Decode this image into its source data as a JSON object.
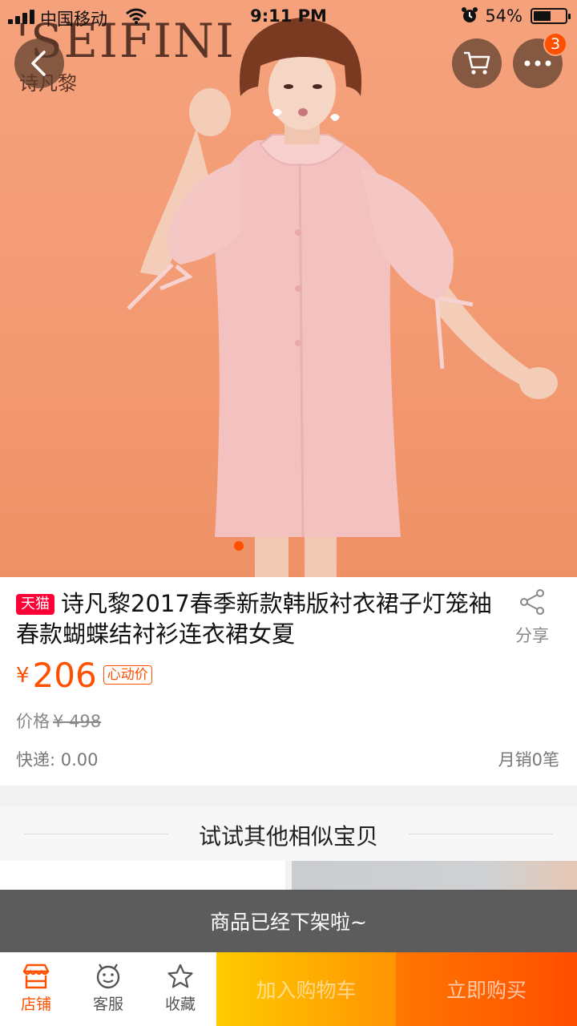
{
  "status_bar": {
    "carrier": "中国移动",
    "time": "9:11 PM",
    "battery_percent": "54%",
    "battery_level": 0.54
  },
  "hero": {
    "brand_logo": "'SEIFINI",
    "brand_sub": "诗凡黎",
    "image_count_current": 1
  },
  "nav": {
    "back_icon": "chevron-left-icon",
    "cart_icon": "cart-icon",
    "more_icon": "more-dots-icon",
    "more_badge": "3"
  },
  "product": {
    "platform_tag": "天猫",
    "title": "诗凡黎2017春季新款韩版衬衣裙子灯笼袖春款蝴蝶结衬衫连衣裙女夏",
    "share_label": "分享",
    "currency": "¥",
    "price": "206",
    "price_tag": "心动价",
    "original_label": "价格",
    "original_price": "¥ 498",
    "shipping": "快递: 0.00",
    "monthly_sales": "月销0笔"
  },
  "similar": {
    "heading": "试试其他相似宝贝"
  },
  "toast": {
    "message": "商品已经下架啦~"
  },
  "bottom_bar": {
    "store_label": "店铺",
    "service_label": "客服",
    "favorite_label": "收藏",
    "add_to_cart_label": "加入购物车",
    "buy_now_label": "立即购买"
  },
  "colors": {
    "accent": "#ff5000",
    "tmall_red": "#ff0036",
    "cart_button": "#ffa400",
    "buy_button": "#ff5a00",
    "toast_bg": "#555555"
  }
}
